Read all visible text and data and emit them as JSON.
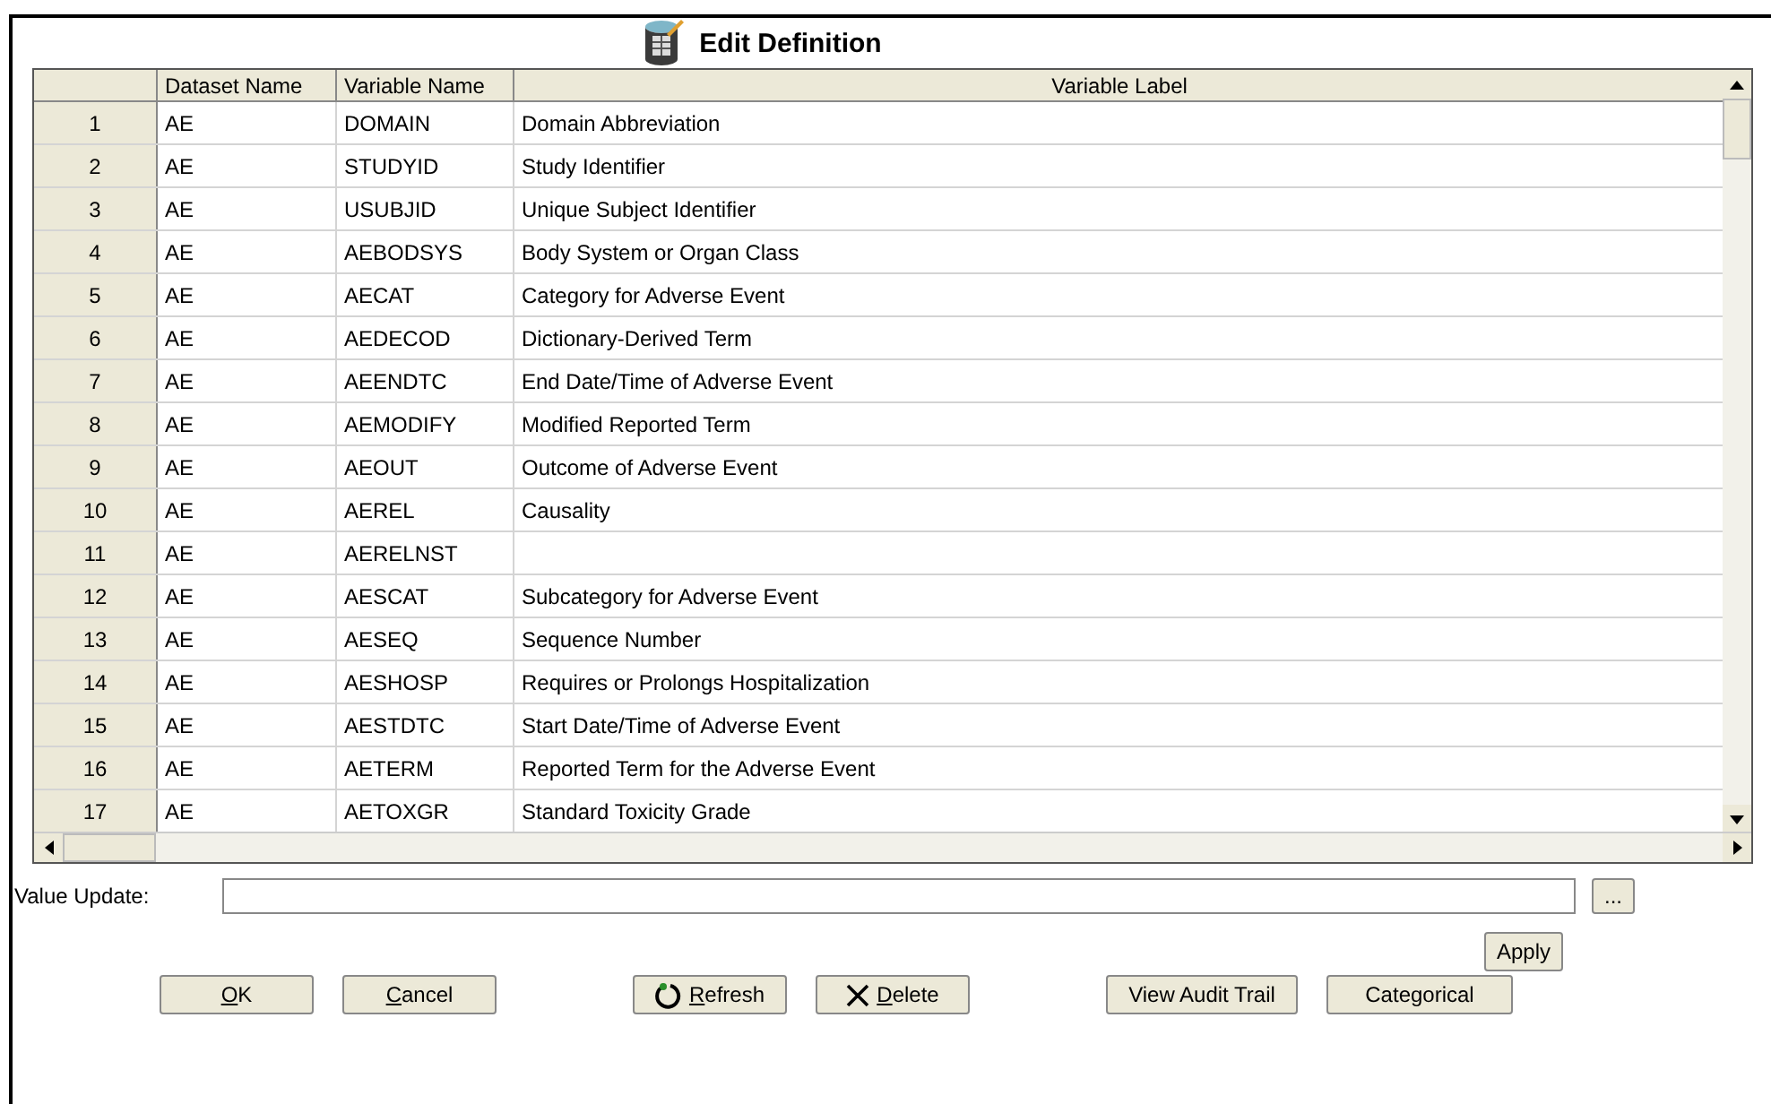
{
  "title": "Edit Definition",
  "table": {
    "columns": [
      "Dataset Name",
      "Variable Name",
      "Variable Label"
    ],
    "rows": [
      {
        "num": "1",
        "dataset": "AE",
        "variable": "DOMAIN",
        "label": "Domain Abbreviation"
      },
      {
        "num": "2",
        "dataset": "AE",
        "variable": "STUDYID",
        "label": "Study Identifier"
      },
      {
        "num": "3",
        "dataset": "AE",
        "variable": "USUBJID",
        "label": "Unique Subject Identifier"
      },
      {
        "num": "4",
        "dataset": "AE",
        "variable": "AEBODSYS",
        "label": "Body System or Organ Class"
      },
      {
        "num": "5",
        "dataset": "AE",
        "variable": "AECAT",
        "label": "Category for Adverse Event"
      },
      {
        "num": "6",
        "dataset": "AE",
        "variable": "AEDECOD",
        "label": "Dictionary-Derived Term"
      },
      {
        "num": "7",
        "dataset": "AE",
        "variable": "AEENDTC",
        "label": "End Date/Time of Adverse Event"
      },
      {
        "num": "8",
        "dataset": "AE",
        "variable": "AEMODIFY",
        "label": "Modified Reported Term"
      },
      {
        "num": "9",
        "dataset": "AE",
        "variable": "AEOUT",
        "label": "Outcome of Adverse Event"
      },
      {
        "num": "10",
        "dataset": "AE",
        "variable": "AEREL",
        "label": "Causality"
      },
      {
        "num": "11",
        "dataset": "AE",
        "variable": "AERELNST"
      },
      {
        "num": "12",
        "dataset": "AE",
        "variable": "AESCAT",
        "label": "Subcategory for Adverse Event"
      },
      {
        "num": "13",
        "dataset": "AE",
        "variable": "AESEQ",
        "label": "Sequence Number"
      },
      {
        "num": "14",
        "dataset": "AE",
        "variable": "AESHOSP",
        "label": "Requires or Prolongs Hospitalization"
      },
      {
        "num": "15",
        "dataset": "AE",
        "variable": "AESTDTC",
        "label": "Start Date/Time of Adverse Event"
      },
      {
        "num": "16",
        "dataset": "AE",
        "variable": "AETERM",
        "label": "Reported Term for the Adverse Event"
      },
      {
        "num": "17",
        "dataset": "AE",
        "variable": "AETOXGR",
        "label": "Standard Toxicity Grade"
      }
    ]
  },
  "value_update": {
    "label": "Value Update:",
    "browse": "...",
    "apply": "Apply"
  },
  "buttons": [
    {
      "kind": "plain",
      "label": "OK",
      "underline_first": true
    },
    {
      "kind": "plain",
      "label": "Cancel",
      "underline_first": true
    },
    {
      "kind": "refresh",
      "label": "Refresh",
      "underline_first": true
    },
    {
      "kind": "delete",
      "label": "Delete",
      "underline_first": true
    },
    {
      "kind": "plain",
      "label": "View Audit Trail",
      "underline_first": false
    },
    {
      "kind": "plain",
      "label": "Categorical",
      "underline_first": false
    }
  ]
}
